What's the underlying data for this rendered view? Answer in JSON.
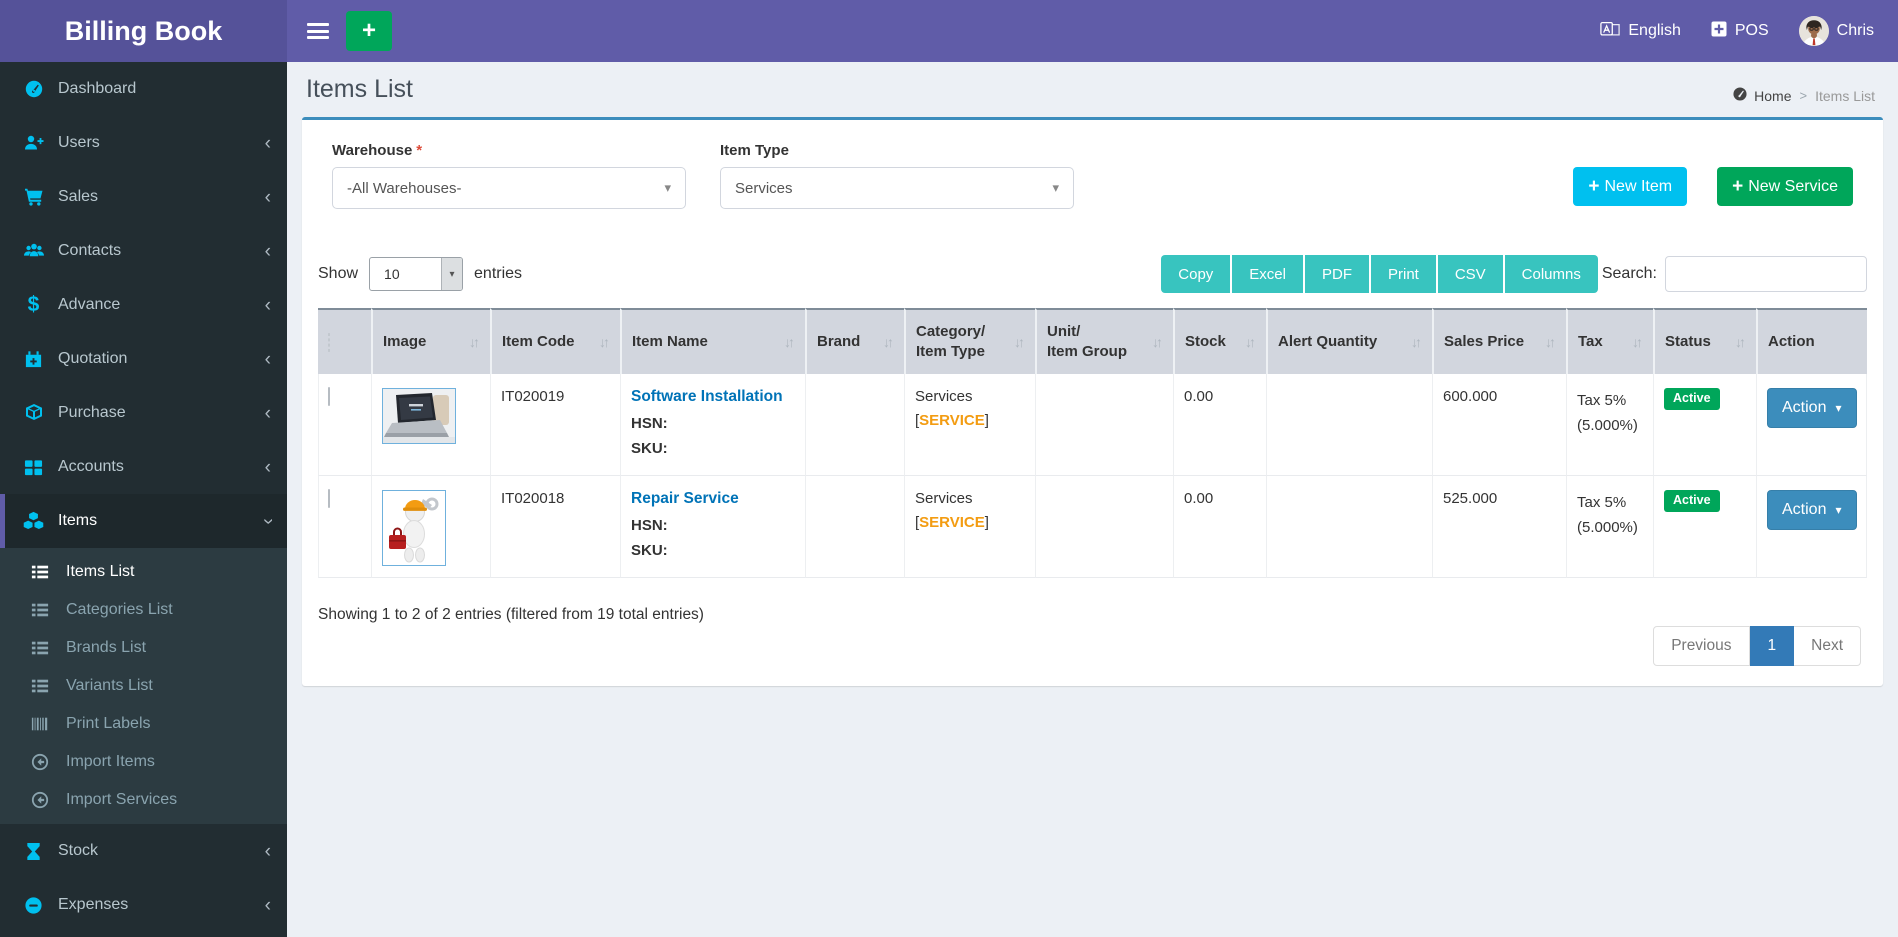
{
  "colors": {
    "navbar": "#605ca8",
    "logo_bg": "#555299",
    "sidebar_bg": "#222d32",
    "sidebar_active_border": "#605ca8",
    "sidebar_icon": "#00c0ef",
    "content_bg": "#ecf0f5",
    "card_top_border": "#3c8dbc",
    "primary_btn": "#3c8dbc",
    "info_btn": "#00c0ef",
    "success_btn": "#00a65a",
    "export_btn": "#38c4bf",
    "link": "#0073b7",
    "tag_orange": "#f39c12",
    "badge_active": "#00a65a",
    "table_header_bg": "#d2d6de",
    "pagination_active": "#337ab7",
    "required": "#dd4b39"
  },
  "icons": {
    "sort_icon": "↓↑",
    "caret_down": "▾",
    "chevron_left": "‹",
    "plus": "+"
  },
  "topbar": {
    "brand": "Billing Book",
    "language_label": "English",
    "pos_label": "POS",
    "user_name": "Chris"
  },
  "sidebar": {
    "items": [
      {
        "label": "Dashboard"
      },
      {
        "label": "Users"
      },
      {
        "label": "Sales"
      },
      {
        "label": "Contacts"
      },
      {
        "label": "Advance"
      },
      {
        "label": "Quotation"
      },
      {
        "label": "Purchase"
      },
      {
        "label": "Accounts"
      },
      {
        "label": "Items"
      },
      {
        "label": "Stock"
      },
      {
        "label": "Expenses"
      }
    ],
    "items_submenu": [
      {
        "label": "Items List"
      },
      {
        "label": "Categories List"
      },
      {
        "label": "Brands List"
      },
      {
        "label": "Variants List"
      },
      {
        "label": "Print Labels"
      },
      {
        "label": "Import Items"
      },
      {
        "label": "Import Services"
      }
    ],
    "dollar_glyph": "$"
  },
  "page": {
    "title": "Items List",
    "breadcrumb": {
      "home": "Home",
      "separator": ">",
      "current": "Items List"
    }
  },
  "filters": {
    "warehouse_label": "Warehouse",
    "required_mark": "*",
    "warehouse_value": "-All Warehouses-",
    "item_type_label": "Item Type",
    "item_type_value": "Services"
  },
  "header_actions": {
    "new_item": "New Item",
    "new_service": "New Service"
  },
  "controls": {
    "show_label": "Show",
    "page_length": "10",
    "entries_label": "entries",
    "export_buttons": [
      "Copy",
      "Excel",
      "PDF",
      "Print",
      "CSV",
      "Columns"
    ],
    "search_label": "Search:",
    "search_value": ""
  },
  "table": {
    "columns": [
      {
        "line1": "Image",
        "line2": ""
      },
      {
        "line1": "Item Code",
        "line2": ""
      },
      {
        "line1": "Item Name",
        "line2": ""
      },
      {
        "line1": "Brand",
        "line2": ""
      },
      {
        "line1": "Category/",
        "line2": "Item Type"
      },
      {
        "line1": "Unit/",
        "line2": "Item Group"
      },
      {
        "line1": "Stock",
        "line2": ""
      },
      {
        "line1": "Alert Quantity",
        "line2": ""
      },
      {
        "line1": "Sales Price",
        "line2": ""
      },
      {
        "line1": "Tax",
        "line2": ""
      },
      {
        "line1": "Status",
        "line2": ""
      },
      {
        "line1": "Action",
        "line2": ""
      }
    ],
    "rows": [
      {
        "image": "laptop-product-photo",
        "item_code": "IT020019",
        "item_name": "Software Installation",
        "hsn_label": "HSN:",
        "sku_label": "SKU:",
        "brand": "",
        "category": "Services",
        "bracket_open": "[",
        "item_type_tag": "SERVICE",
        "bracket_close": "]",
        "unit_group": "",
        "stock": "0.00",
        "alert_quantity": "",
        "sales_price": "600.000",
        "tax_line1": "Tax 5%",
        "tax_line2": "(5.000%)",
        "status": "Active",
        "action_label": "Action"
      },
      {
        "image": "repair-service-mascot-photo",
        "item_code": "IT020018",
        "item_name": "Repair Service",
        "hsn_label": "HSN:",
        "sku_label": "SKU:",
        "brand": "",
        "category": "Services",
        "bracket_open": "[",
        "item_type_tag": "SERVICE",
        "bracket_close": "]",
        "unit_group": "",
        "stock": "0.00",
        "alert_quantity": "",
        "sales_price": "525.000",
        "tax_line1": "Tax 5%",
        "tax_line2": "(5.000%)",
        "status": "Active",
        "action_label": "Action"
      }
    ]
  },
  "table_footer": {
    "summary": "Showing 1 to 2 of 2 entries (filtered from 19 total entries)",
    "previous_label": "Previous",
    "page_number": "1",
    "next_label": "Next"
  }
}
